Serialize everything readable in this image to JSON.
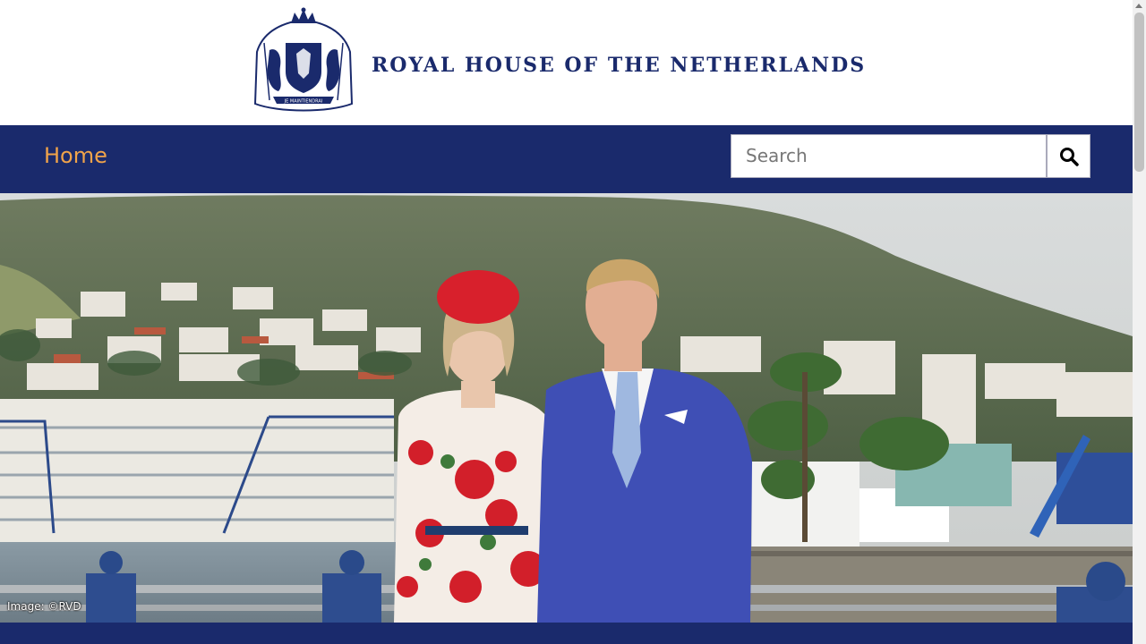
{
  "header": {
    "site_title": "ROYAL HOUSE OF THE NETHERLANDS",
    "crest_motto": "JE MAINTIENDRAI"
  },
  "nav": {
    "home_label": "Home"
  },
  "search": {
    "placeholder": "Search",
    "value": ""
  },
  "hero": {
    "image_credit": "Image: ©RVD"
  },
  "colors": {
    "brand_navy": "#1a2a6c",
    "nav_link": "#f0a34a"
  },
  "icons": {
    "search_button": "search-icon",
    "crest": "coat-of-arms-icon"
  }
}
